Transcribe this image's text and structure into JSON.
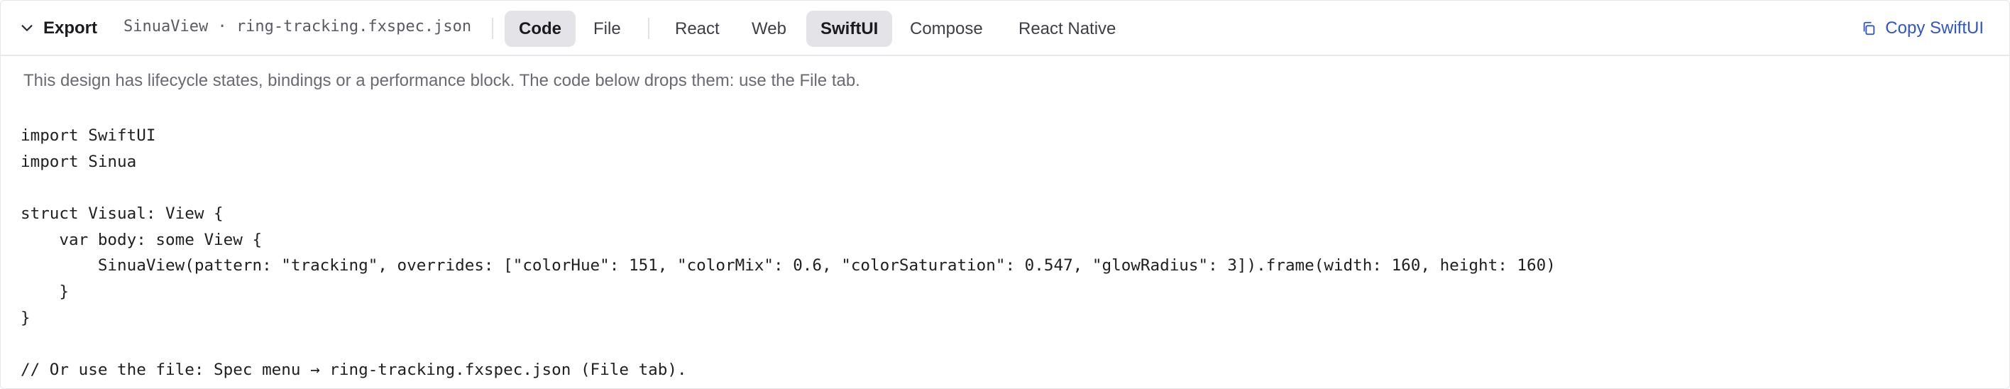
{
  "header": {
    "collapse_label": "Export",
    "file_title": "SinuaView · ring-tracking.fxspec.json",
    "view_tabs": [
      {
        "label": "Code",
        "active": true
      },
      {
        "label": "File",
        "active": false
      }
    ],
    "platform_tabs": [
      {
        "label": "React",
        "active": false
      },
      {
        "label": "Web",
        "active": false
      },
      {
        "label": "SwiftUI",
        "active": true
      },
      {
        "label": "Compose",
        "active": false
      },
      {
        "label": "React Native",
        "active": false
      }
    ],
    "copy_label": "Copy SwiftUI"
  },
  "notice": "This design has lifecycle states, bindings or a performance block. The code below drops them: use the File tab.",
  "code_lines": [
    "import SwiftUI",
    "import Sinua",
    "",
    "struct Visual: View {",
    "    var body: some View {",
    "        SinuaView(pattern: \"tracking\", overrides: [\"colorHue\": 151, \"colorMix\": 0.6, \"colorSaturation\": 0.547, \"glowRadius\": 3]).frame(width: 160, height: 160)",
    "    }",
    "}",
    "",
    "// Or use the file: Spec menu → ring-tracking.fxspec.json (File tab)."
  ],
  "colors": {
    "accent_link": "#2f55c9",
    "active_tab_bg": "#e3e3e8",
    "notice_text": "#6a6a72"
  },
  "icons": {
    "collapse": "chevron-down-icon",
    "copy": "copy-icon"
  }
}
